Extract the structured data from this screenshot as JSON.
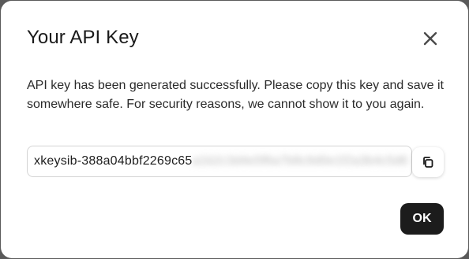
{
  "dialog": {
    "title": "Your API Key",
    "close_icon": "close-icon",
    "message": "API key has been generated successfully. Please copy this key and save it somewhere safe. For security reasons, we cannot show it to you again.",
    "key_field": {
      "visible_value": "xkeysib-388a04bbf2269c65",
      "masked_value": "a1b2c3d4e5f6a7b8c9d0e1f2a3b4c5d6"
    },
    "copy_icon": "copy-icon",
    "ok_label": "OK"
  },
  "colors": {
    "background_overlay": "#5a5a5a",
    "dialog_bg": "#ffffff",
    "ok_button_bg": "#1c1c1c",
    "ok_button_text": "#ffffff",
    "text": "#1a1a1a"
  }
}
